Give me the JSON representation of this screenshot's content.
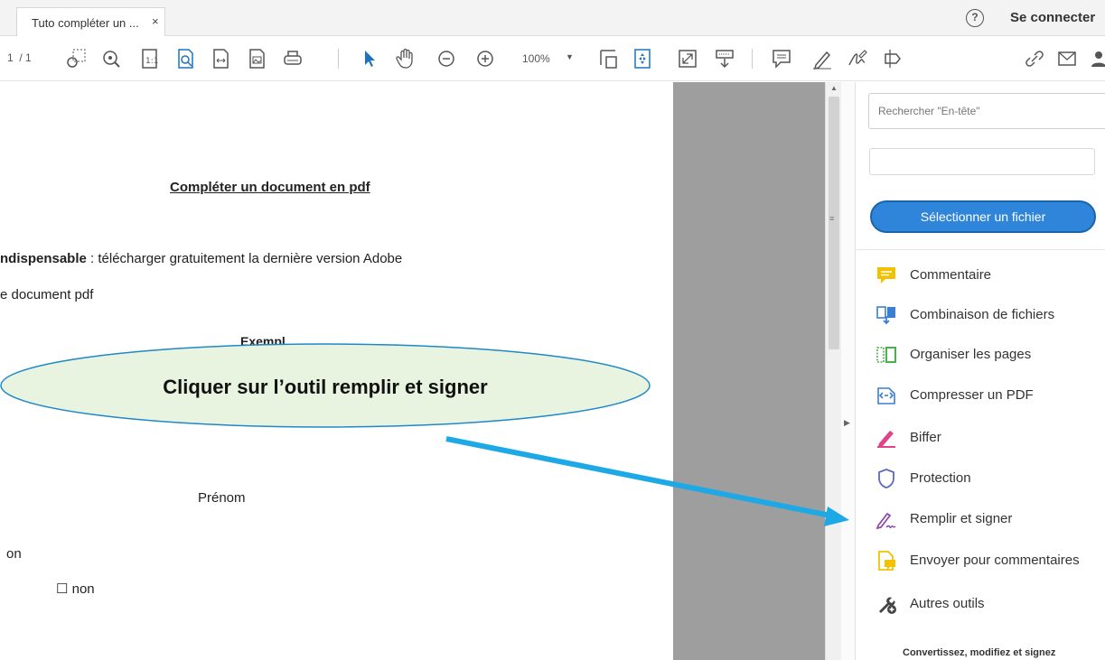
{
  "tab": {
    "title": "Tuto compléter un ...",
    "close": "×"
  },
  "header": {
    "help": "?",
    "signin": "Se connecter"
  },
  "toolbar": {
    "page_current": "1",
    "page_total": "/ 1",
    "zoom": "100%",
    "zoom_caret": "▼"
  },
  "document": {
    "title": "Compléter un document en pdf",
    "line1_bold": "ndispensable",
    "line1_rest": " : télécharger gratuitement la dernière version Adobe",
    "line2": "e document pdf",
    "partial_heading": "Exempl",
    "prenom": "Prénom",
    "on": "on",
    "checkbox_glyph": "☐",
    "non": "non"
  },
  "panel": {
    "search_placeholder": "Rechercher \"En-tête\"",
    "select_file": "Sélectionner un fichier",
    "tools": [
      {
        "label": "Commentaire",
        "icon": "comment-icon",
        "color": "#f2c200"
      },
      {
        "label": "Combinaison de fichiers",
        "icon": "combine-files-icon",
        "color": "#3b7fd4"
      },
      {
        "label": "Organiser les pages",
        "icon": "organize-pages-icon",
        "color": "#4caf50"
      },
      {
        "label": "Compresser un PDF",
        "icon": "compress-pdf-icon",
        "color": "#3b7fd4"
      },
      {
        "label": "Biffer",
        "icon": "redact-icon",
        "color": "#e0438a"
      },
      {
        "label": "Protection",
        "icon": "shield-icon",
        "color": "#5c6bc0"
      },
      {
        "label": "Remplir et signer",
        "icon": "fill-sign-icon",
        "color": "#8e44ad"
      },
      {
        "label": "Envoyer pour commentaires",
        "icon": "send-review-icon",
        "color": "#f2c200"
      },
      {
        "label": "Autres outils",
        "icon": "more-tools-icon",
        "color": "#444444"
      }
    ],
    "footer": "Convertissez, modifiez et signez"
  },
  "callout": {
    "text": "Cliquer sur l’outil remplir et signer",
    "fill": "#e8f4df",
    "stroke": "#1e88c8",
    "arrow_color": "#1ea9e6"
  }
}
